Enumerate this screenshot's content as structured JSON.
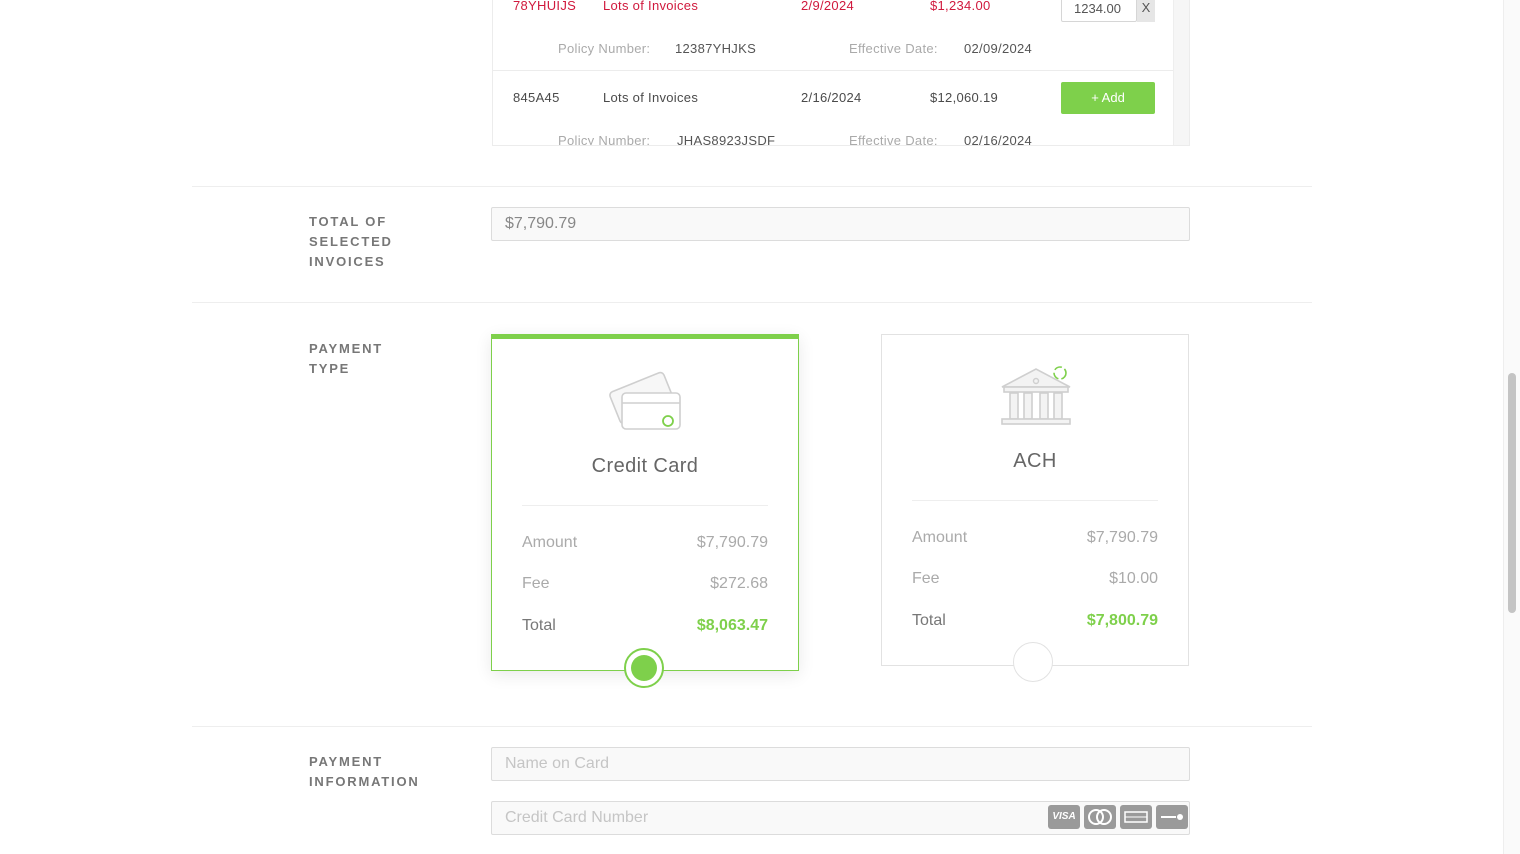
{
  "invoices": {
    "rows": [
      {
        "id": "78YHUIJS",
        "description": "Lots of Invoices",
        "date": "2/9/2024",
        "amount": "$1,234.00",
        "policy_label": "Policy Number:",
        "policy_number": "12387YHJKS",
        "effective_label": "Effective Date:",
        "effective_date": "02/09/2024",
        "entered_amount": "1234.00",
        "remove_label": "X"
      },
      {
        "id": "845A45",
        "description": "Lots of Invoices",
        "date": "2/16/2024",
        "amount": "$12,060.19",
        "policy_label": "Policy Number:",
        "policy_number": "JHAS8923JSDF",
        "effective_label": "Effective Date:",
        "effective_date": "02/16/2024",
        "add_label": "+ Add"
      }
    ],
    "selected_color": "#d0193d"
  },
  "total_section": {
    "label": "TOTAL OF SELECTED INVOICES",
    "label_lines": [
      "TOTAL OF",
      "SELECTED",
      "INVOICES"
    ],
    "value": "$7,790.79"
  },
  "payment_type": {
    "label_lines": [
      "PAYMENT",
      "TYPE"
    ],
    "accent_color": "#7ed04b",
    "options": [
      {
        "title": "Credit Card",
        "icon": "credit-card-icon",
        "selected": true,
        "amount_label": "Amount",
        "amount": "$7,790.79",
        "fee_label": "Fee",
        "fee": "$272.68",
        "total_label": "Total",
        "total": "$8,063.47"
      },
      {
        "title": "ACH",
        "icon": "bank-icon",
        "selected": false,
        "amount_label": "Amount",
        "amount": "$7,790.79",
        "fee_label": "Fee",
        "fee": "$10.00",
        "total_label": "Total",
        "total": "$7,800.79"
      }
    ]
  },
  "payment_information": {
    "label_lines": [
      "PAYMENT",
      "INFORMATION"
    ],
    "name_placeholder": "Name on Card",
    "card_number_placeholder": "Credit Card Number",
    "card_logos": [
      {
        "icon": "visa-icon",
        "text": "VISA"
      },
      {
        "icon": "mastercard-icon",
        "text": ""
      },
      {
        "icon": "amex-icon",
        "text": ""
      },
      {
        "icon": "discover-icon",
        "text": ""
      }
    ]
  }
}
